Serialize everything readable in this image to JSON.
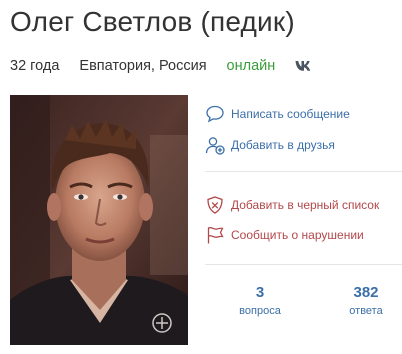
{
  "profile": {
    "name": "Олег Светлов (педик)",
    "age": "32 года",
    "location": "Евпатория, Россия",
    "status": "онлайн",
    "social_icon": "vk-icon"
  },
  "actions": {
    "message": {
      "label": "Написать сообщение",
      "icon": "speech-bubble-icon"
    },
    "add_friend": {
      "label": "Добавить в друзья",
      "icon": "add-user-icon"
    },
    "blacklist": {
      "label": "Добавить в черный список",
      "icon": "shield-x-icon"
    },
    "report": {
      "label": "Сообщить о нарушении",
      "icon": "flag-icon"
    }
  },
  "stats": {
    "questions": {
      "value": "3",
      "label": "вопроса"
    },
    "answers": {
      "value": "382",
      "label": "ответа"
    }
  },
  "colors": {
    "link_blue": "#3b6fa8",
    "danger_red": "#b2484a",
    "online_green": "#3a9d3a"
  }
}
